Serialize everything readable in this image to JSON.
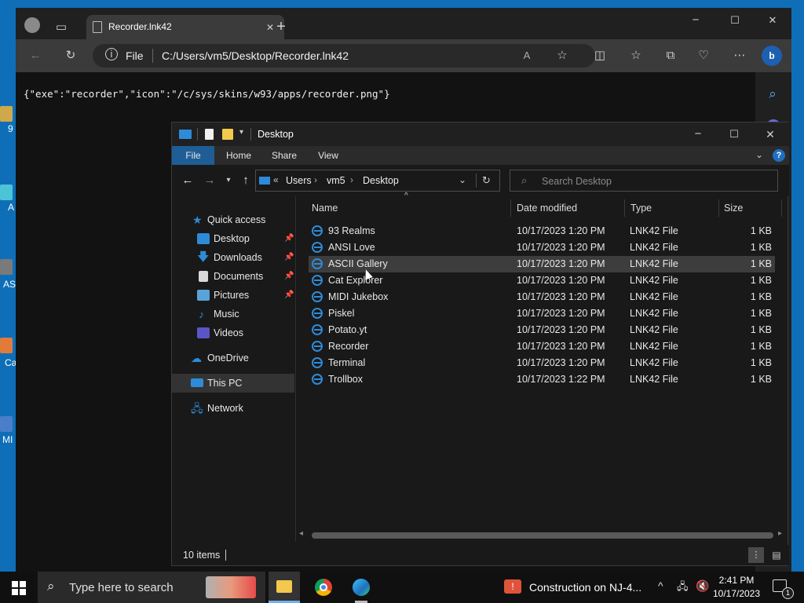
{
  "desktop": {
    "icons": [
      {
        "label": "9"
      },
      {
        "label": "A"
      },
      {
        "label": "AS"
      },
      {
        "label": "Ca"
      },
      {
        "label": "MI"
      }
    ]
  },
  "edge": {
    "tab_title": "Recorder.lnk42",
    "site_info": "File",
    "url": "C:/Users/vm5/Desktop/Recorder.lnk42",
    "content": "{\"exe\":\"recorder\",\"icon\":\"/c/sys/skins/w93/apps/recorder.png\"}",
    "icons": [
      "profile-icon",
      "tab-actions-icon",
      "close-tab-icon",
      "new-tab-icon",
      "back-icon",
      "refresh-icon",
      "info-icon",
      "read-aloud-icon",
      "favorite-icon",
      "split-screen-icon",
      "favorites-icon",
      "collections-icon",
      "performance-icon",
      "more-icon",
      "copilot-icon",
      "search-icon"
    ]
  },
  "explorer": {
    "title": "Desktop",
    "ribbon_tabs": [
      "File",
      "Home",
      "Share",
      "View"
    ],
    "breadcrumb": {
      "chev": "«",
      "parts": [
        "Users",
        "vm5",
        "Desktop"
      ]
    },
    "search_placeholder": "Search Desktop",
    "nav": {
      "quick_access": "Quick access",
      "items": [
        {
          "label": "Desktop",
          "pinned": true
        },
        {
          "label": "Downloads",
          "pinned": true
        },
        {
          "label": "Documents",
          "pinned": true
        },
        {
          "label": "Pictures",
          "pinned": true
        },
        {
          "label": "Music",
          "pinned": false
        },
        {
          "label": "Videos",
          "pinned": false
        }
      ],
      "onedrive": "OneDrive",
      "this_pc": "This PC",
      "network": "Network"
    },
    "columns": [
      "Name",
      "Date modified",
      "Type",
      "Size"
    ],
    "files": [
      {
        "name": "93 Realms",
        "date": "10/17/2023 1:20 PM",
        "type": "LNK42 File",
        "size": "1 KB"
      },
      {
        "name": "ANSI Love",
        "date": "10/17/2023 1:20 PM",
        "type": "LNK42 File",
        "size": "1 KB"
      },
      {
        "name": "ASCII Gallery",
        "date": "10/17/2023 1:20 PM",
        "type": "LNK42 File",
        "size": "1 KB"
      },
      {
        "name": "Cat Explorer",
        "date": "10/17/2023 1:20 PM",
        "type": "LNK42 File",
        "size": "1 KB"
      },
      {
        "name": "MIDI Jukebox",
        "date": "10/17/2023 1:20 PM",
        "type": "LNK42 File",
        "size": "1 KB"
      },
      {
        "name": "Piskel",
        "date": "10/17/2023 1:20 PM",
        "type": "LNK42 File",
        "size": "1 KB"
      },
      {
        "name": "Potato.yt",
        "date": "10/17/2023 1:20 PM",
        "type": "LNK42 File",
        "size": "1 KB"
      },
      {
        "name": "Recorder",
        "date": "10/17/2023 1:20 PM",
        "type": "LNK42 File",
        "size": "1 KB"
      },
      {
        "name": "Terminal",
        "date": "10/17/2023 1:20 PM",
        "type": "LNK42 File",
        "size": "1 KB"
      },
      {
        "name": "Trollbox",
        "date": "10/17/2023 1:22 PM",
        "type": "LNK42 File",
        "size": "1 KB"
      }
    ],
    "hovered_row": 2,
    "status": "10 items"
  },
  "taskbar": {
    "search_placeholder": "Type here to search",
    "news": "Construction on NJ-4...",
    "time": "2:41 PM",
    "date": "10/17/2023",
    "notification_count": "1"
  },
  "colors": {
    "desktop": "#0e6fb8",
    "accent": "#2e8bd8",
    "hover_row": "#3d3d3d"
  }
}
